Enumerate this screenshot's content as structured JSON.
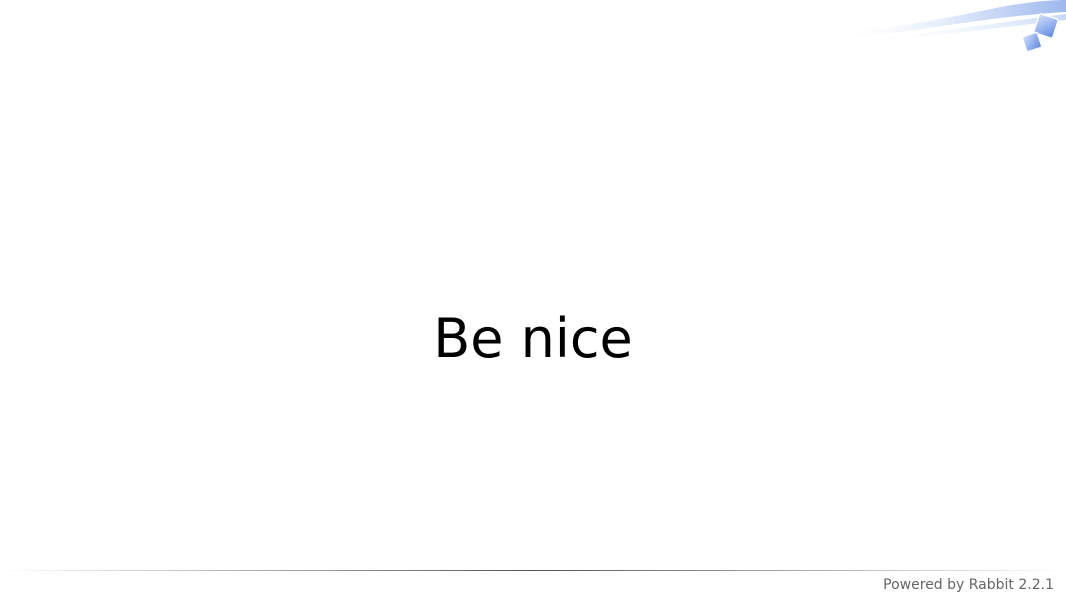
{
  "slide": {
    "title": "Be nice"
  },
  "footer": {
    "credit": "Powered by Rabbit 2.2.1"
  },
  "theme": {
    "accent": "#5b86e5",
    "swoosh_light": "#dfe9fb",
    "text": "#000000",
    "footer_text": "#666666"
  }
}
